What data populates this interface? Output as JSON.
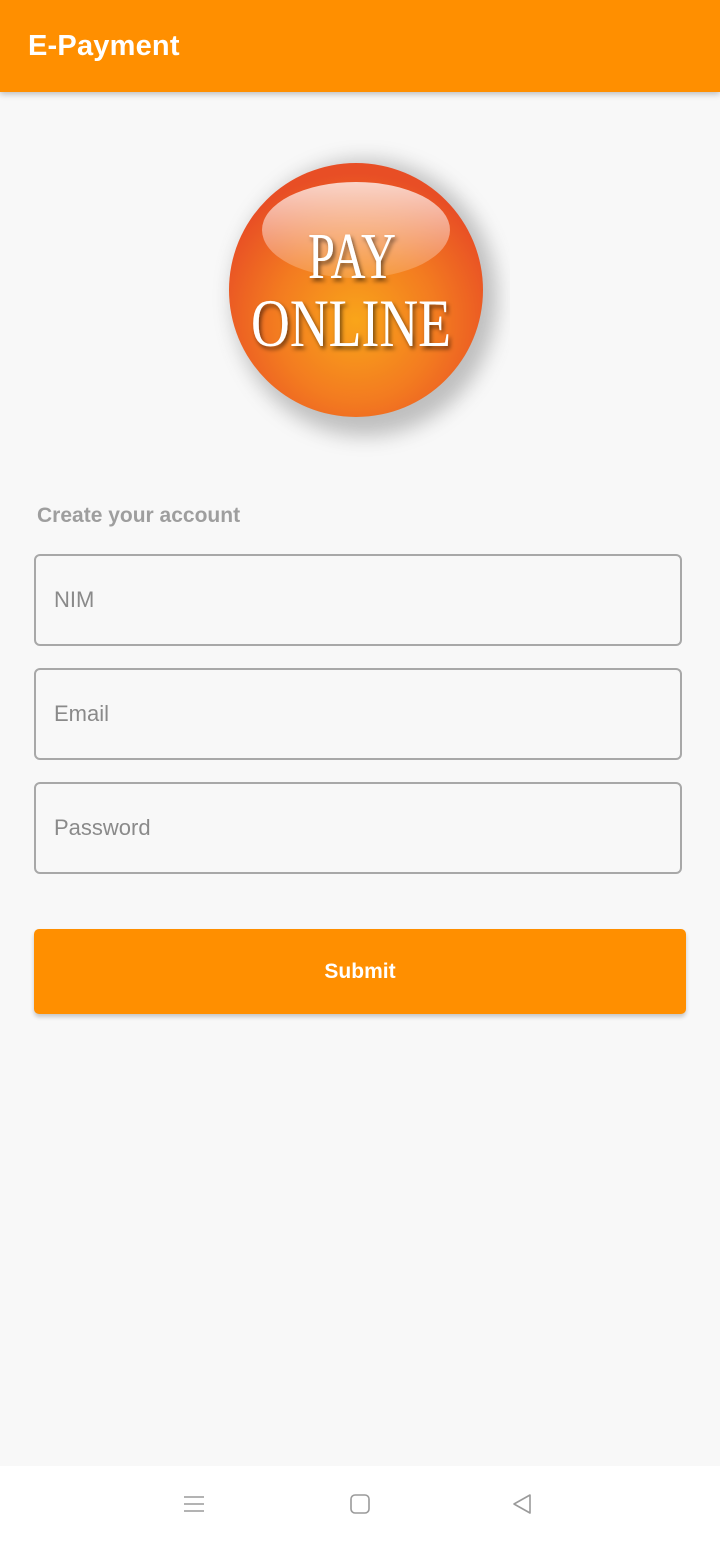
{
  "app_bar": {
    "title": "E-Payment",
    "color": "#ff8f00"
  },
  "logo": {
    "line1": "PAY",
    "line2": "ONLINE"
  },
  "form": {
    "heading": "Create your account",
    "nim_placeholder": "NIM",
    "email_placeholder": "Email",
    "password_placeholder": "Password",
    "nim_value": "",
    "email_value": "",
    "password_value": "",
    "submit_label": "Submit"
  },
  "nav_bar": {
    "icons": [
      "menu-icon",
      "home-icon",
      "back-icon"
    ]
  }
}
